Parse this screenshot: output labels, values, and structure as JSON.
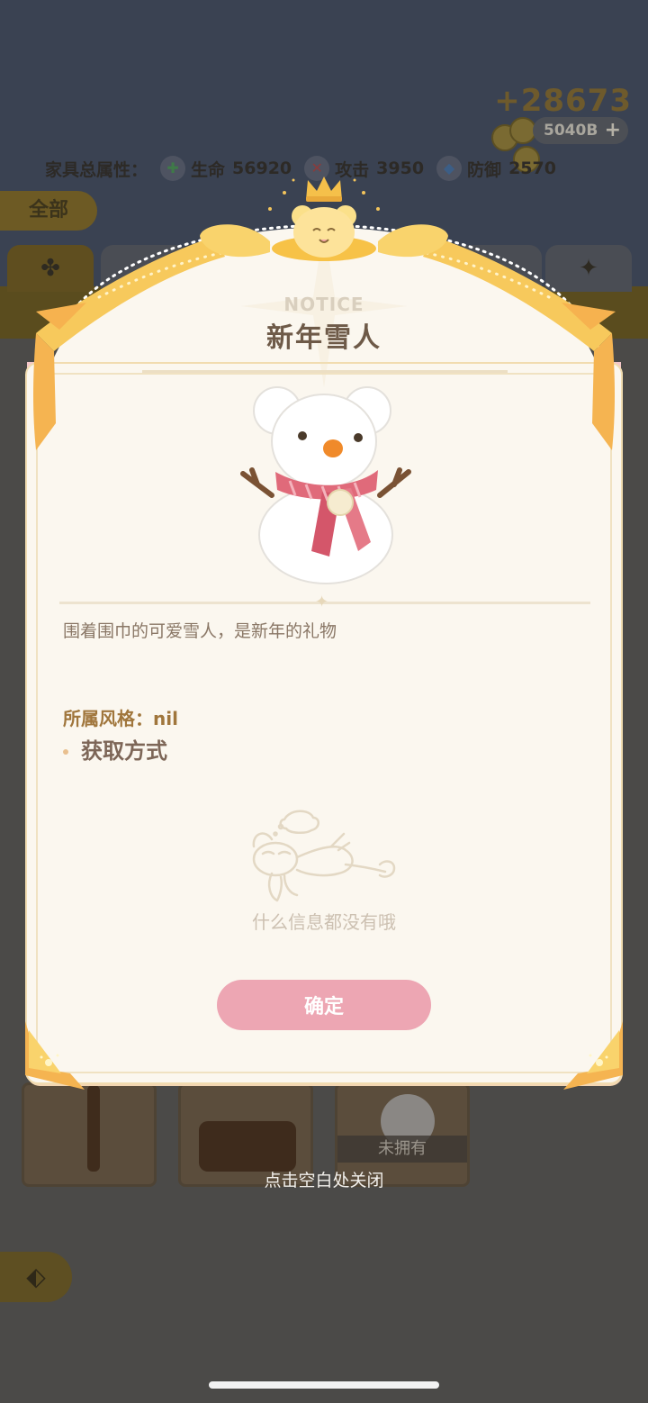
{
  "currency": {
    "big_amount": "+28673",
    "pill_amount": "5040B",
    "pill_plus": "+"
  },
  "attributes": {
    "label": "家具总属性：",
    "hp_label": "生命",
    "hp_value": "56920",
    "atk_label": "攻击",
    "atk_value": "3950",
    "def_label": "防御",
    "def_value": "2570"
  },
  "tabs": {
    "all_label": "全部"
  },
  "cards": {
    "not_owned_label": "未拥有"
  },
  "dialog": {
    "notice_label": "NOTICE",
    "title": "新年雪人",
    "description": "围着围巾的可爱雪人，是新年的礼物",
    "style_label": "所属风格：",
    "style_value": "nil",
    "acquire_label": "获取方式",
    "empty_text": "什么信息都没有哦",
    "confirm_label": "确定"
  },
  "close_hint": "点击空白处关闭",
  "colors": {
    "confirm_button": "#eda6b3",
    "ribbon_gold": "#f7c95c",
    "dialog_background": "#fbf7ef",
    "title_text": "#6e5a48"
  },
  "icons": [
    "coin-icon",
    "plus-icon",
    "heart-cross-icon",
    "sword-icon",
    "shield-icon",
    "clover-icon",
    "sparkle-icon",
    "back-arrow-icon",
    "crown-icon",
    "bear-face-icon",
    "ribbon-bow-icon",
    "snowman-icon",
    "sleeping-mascot-icon",
    "star-divider-icon"
  ]
}
